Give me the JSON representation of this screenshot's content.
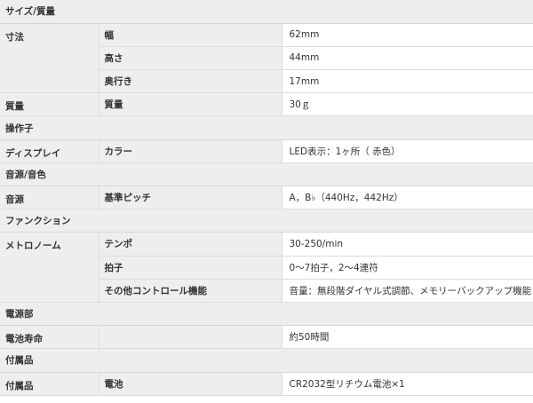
{
  "sections": {
    "size_weight": "サイズ/質量",
    "controls": "操作子",
    "sound_source": "音源/音色",
    "function": "ファンクション",
    "power": "電源部",
    "accessories": "付属品"
  },
  "rows": {
    "dimensions": {
      "category": "寸法",
      "width": {
        "label": "幅",
        "value": "62mm"
      },
      "height": {
        "label": "高さ",
        "value": "44mm"
      },
      "depth": {
        "label": "奥行き",
        "value": "17mm"
      }
    },
    "weight": {
      "category": "質量",
      "label": "質量",
      "value": "30ｇ"
    },
    "display": {
      "category": "ディスプレイ",
      "label": "カラー",
      "value": "LED表示：1ヶ所（ 赤色）"
    },
    "sound": {
      "category": "音源",
      "label": "基準ピッチ",
      "value": "A，B♭（440Hz，442Hz）"
    },
    "metronome": {
      "category": "メトロノーム",
      "tempo": {
        "label": "テンポ",
        "value": "30-250/min"
      },
      "beat": {
        "label": "拍子",
        "value": "0〜7拍子，2〜4連符"
      },
      "other": {
        "label": "その他コントロール機能",
        "value": "音量：無段階ダイヤル式調節、メモリーバックアップ機能"
      }
    },
    "battery": {
      "category": "電池寿命",
      "value": "約50時間"
    },
    "accessory": {
      "category": "付属品",
      "label": "電池",
      "value": "CR2032型リチウム電池×1"
    }
  }
}
